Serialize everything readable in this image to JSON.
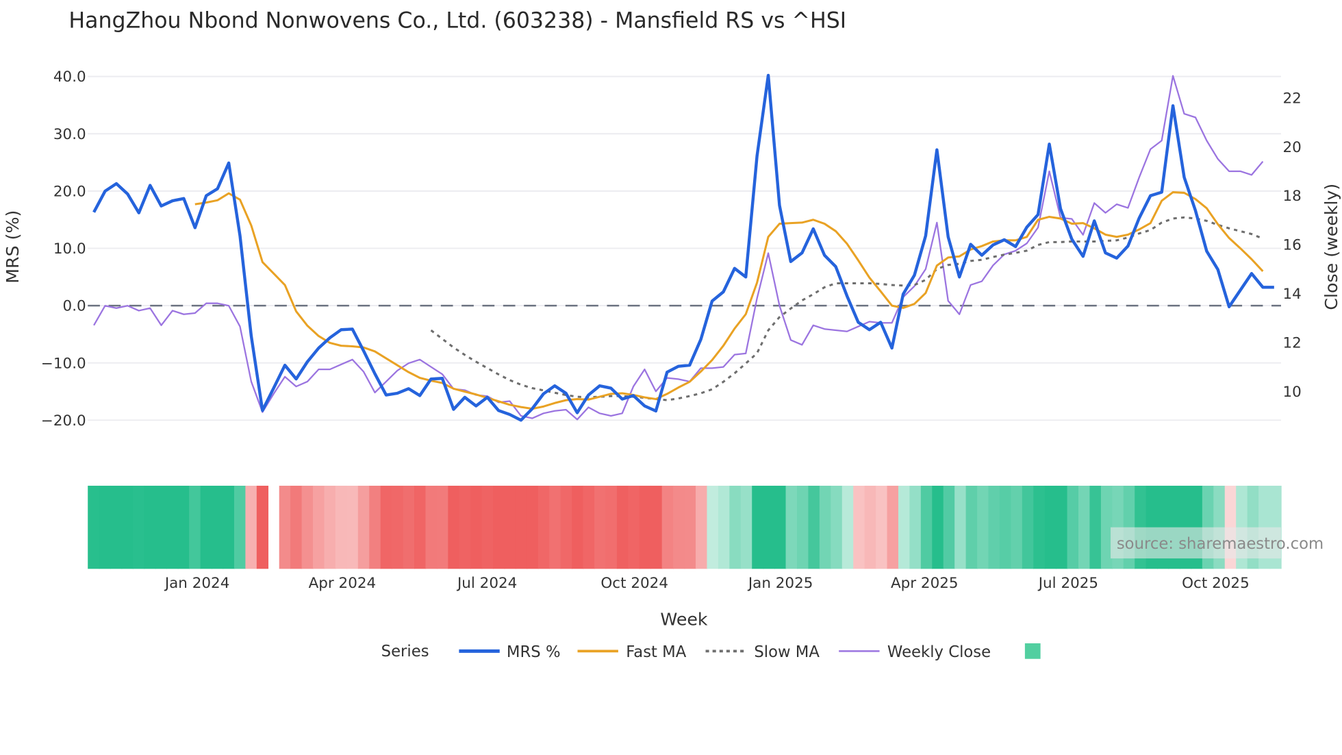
{
  "chart_data": {
    "type": "line",
    "title": "HangZhou Nbond Nonwovens Co., Ltd. (603238) - Mansfield RS vs ^HSI",
    "xlabel": "Week",
    "ylabel": "MRS (%)",
    "y2label": "Close (weekly)",
    "ylim": [
      -20,
      40
    ],
    "y2lim": [
      10,
      22
    ],
    "y_ticks": [
      "40.0",
      "30.0",
      "20.0",
      "10.0",
      "0.0",
      "−10.0",
      "−20.0"
    ],
    "y_tick_values": [
      40,
      30,
      20,
      10,
      0,
      -10,
      -20
    ],
    "y2_ticks": [
      "22",
      "20",
      "18",
      "16",
      "14",
      "12",
      "10"
    ],
    "y2_tick_values": [
      22,
      20,
      18,
      16,
      14,
      12,
      10
    ],
    "x_ticks": [
      {
        "label": "Jan 2024",
        "week": 9.2
      },
      {
        "label": "Apr 2024",
        "week": 22.1
      },
      {
        "label": "Jul 2024",
        "week": 35.0
      },
      {
        "label": "Oct 2024",
        "week": 48.1
      },
      {
        "label": "Jan 2025",
        "week": 61.1
      },
      {
        "label": "Apr 2025",
        "week": 73.9
      },
      {
        "label": "Jul 2025",
        "week": 86.7
      },
      {
        "label": "Oct 2025",
        "week": 99.8
      }
    ],
    "grid": true,
    "reference_line": 0,
    "legend_title": "Series",
    "legend_position": "bottom",
    "series": [
      {
        "name": "MRS %",
        "color": "#2563dc",
        "axis": "left",
        "values": [
          16.3,
          20,
          21.3,
          19.5,
          16.2,
          21,
          17.4,
          18.3,
          18.7,
          13.6,
          19.2,
          20.4,
          24.9,
          12.2,
          -5.3,
          -18.3,
          -14.4,
          -10.4,
          -12.8,
          -9.8,
          -7.4,
          -5.6,
          -4.2,
          -4.1,
          -7.9,
          -11.9,
          -15.6,
          -15.3,
          -14.5,
          -15.7,
          -12.8,
          -12.7,
          -18.1,
          -16,
          -17.5,
          -16,
          -18.3,
          -19,
          -20,
          -18,
          -15.4,
          -14,
          -15.3,
          -18.7,
          -15.6,
          -14,
          -14.4,
          -16.3,
          -15.7,
          -17.5,
          -18.4,
          -11.6,
          -10.6,
          -10.4,
          -5.9,
          0.8,
          2.4,
          6.5,
          5,
          26.1,
          40.2,
          17.5,
          7.7,
          9.2,
          13.4,
          8.8,
          6.8,
          1.7,
          -2.9,
          -4.2,
          -2.9,
          -7.4,
          2,
          5.3,
          12.2,
          27.2,
          12,
          5,
          10.7,
          8.8,
          10.6,
          11.5,
          10.3,
          13.7,
          15.9,
          28.2,
          16.9,
          11.6,
          8.6,
          14.8,
          9.2,
          8.3,
          10.4,
          15.3,
          19.2,
          19.8,
          34.9,
          22.4,
          16.6,
          9.5,
          6.3,
          -0.2,
          2.7,
          5.6,
          3.2,
          3.2
        ]
      },
      {
        "name": "Fast MA",
        "color": "#e9a224",
        "axis": "left",
        "values": [
          null,
          null,
          null,
          null,
          null,
          null,
          null,
          null,
          null,
          17.7,
          18,
          18.4,
          19.6,
          18.5,
          14,
          7.6,
          5.6,
          3.6,
          -1,
          -3.5,
          -5.3,
          -6.5,
          -7,
          -7.1,
          -7.3,
          -8,
          -9.2,
          -10.4,
          -11.6,
          -12.6,
          -13.1,
          -13.5,
          -14.5,
          -15,
          -15.5,
          -16.1,
          -16.7,
          -17.3,
          -17.7,
          -18,
          -17.6,
          -17,
          -16.5,
          -16.3,
          -16.4,
          -15.9,
          -15.4,
          -15.3,
          -15.6,
          -16,
          -16.3,
          -15.4,
          -14.3,
          -13.3,
          -11.5,
          -9.5,
          -7,
          -4,
          -1.5,
          4,
          12,
          14.3,
          14.4,
          14.5,
          15,
          14.3,
          13,
          10.8,
          7.9,
          4.9,
          2.5,
          0,
          -0.4,
          0.3,
          2.2,
          7,
          8.4,
          8.6,
          9.8,
          10.4,
          11.2,
          11.4,
          11.4,
          12,
          15,
          15.5,
          15.2,
          14.3,
          14.4,
          13.5,
          12.4,
          12,
          12.4,
          13.3,
          14.4,
          18.3,
          19.8,
          19.7,
          18.6,
          17,
          14.2,
          11.8,
          10,
          8.1,
          6
        ]
      },
      {
        "name": "Slow MA",
        "color": "#6e6e6e",
        "axis": "left",
        "dash": true,
        "values": [
          null,
          null,
          null,
          null,
          null,
          null,
          null,
          null,
          null,
          null,
          null,
          null,
          null,
          null,
          null,
          null,
          null,
          null,
          null,
          null,
          null,
          null,
          null,
          null,
          null,
          null,
          null,
          null,
          null,
          null,
          -4.3,
          -5.8,
          -7.3,
          -8.6,
          -9.8,
          -10.9,
          -12,
          -13,
          -13.8,
          -14.4,
          -14.8,
          -15.2,
          -15.6,
          -15.9,
          -16,
          -15.9,
          -15.8,
          -15.8,
          -15.9,
          -16.1,
          -16.3,
          -16.5,
          -16.2,
          -15.8,
          -15.3,
          -14.6,
          -13.3,
          -11.8,
          -10.1,
          -8.3,
          -4.3,
          -2,
          -0.5,
          0.9,
          2,
          3.2,
          3.9,
          3.9,
          3.9,
          3.9,
          3.8,
          3.6,
          3.5,
          3.6,
          4.5,
          6.4,
          7.1,
          7.3,
          7.8,
          8,
          8.5,
          8.9,
          9.2,
          9.6,
          10.6,
          11.1,
          11.1,
          11.2,
          11.2,
          11.2,
          11.3,
          11.4,
          11.9,
          12.6,
          13.2,
          14.5,
          15.2,
          15.4,
          15.2,
          14.8,
          14.1,
          13.5,
          13,
          12.5,
          11.7
        ]
      },
      {
        "name": "Weekly Close",
        "color": "#9b74e0",
        "axis": "right",
        "values": [
          12.7,
          13.5,
          13.4,
          13.5,
          13.3,
          13.4,
          12.7,
          13.3,
          13.15,
          13.2,
          13.6,
          13.6,
          13.5,
          12.65,
          10.4,
          9.15,
          9.9,
          10.6,
          10.2,
          10.4,
          10.9,
          10.9,
          11.1,
          11.3,
          10.8,
          9.95,
          10.4,
          10.85,
          11.15,
          11.3,
          11,
          10.7,
          10.1,
          10.05,
          9.85,
          9.8,
          9.55,
          9.6,
          9,
          8.9,
          9.1,
          9.2,
          9.25,
          8.85,
          9.35,
          9.1,
          9,
          9.1,
          10.2,
          10.9,
          10,
          10.55,
          10.5,
          10.4,
          10.95,
          10.95,
          11,
          11.5,
          11.55,
          13.8,
          15.65,
          13.5,
          12.1,
          11.9,
          12.7,
          12.55,
          12.5,
          12.45,
          12.65,
          12.85,
          12.8,
          12.8,
          13.85,
          14.3,
          15,
          16.9,
          13.7,
          13.15,
          14.35,
          14.5,
          15.15,
          15.6,
          15.75,
          16.05,
          16.7,
          19,
          17.1,
          17.05,
          16.4,
          17.7,
          17.3,
          17.65,
          17.5,
          18.75,
          19.9,
          20.25,
          22.9,
          21.35,
          21.2,
          20.25,
          19.5,
          19,
          19,
          18.85,
          19.4
        ]
      }
    ],
    "heatmap_gap_week": 16,
    "colors": {
      "positive": "#26be8c",
      "negative": "#ef5f5f"
    },
    "source": "source: sharemaestro.com"
  }
}
